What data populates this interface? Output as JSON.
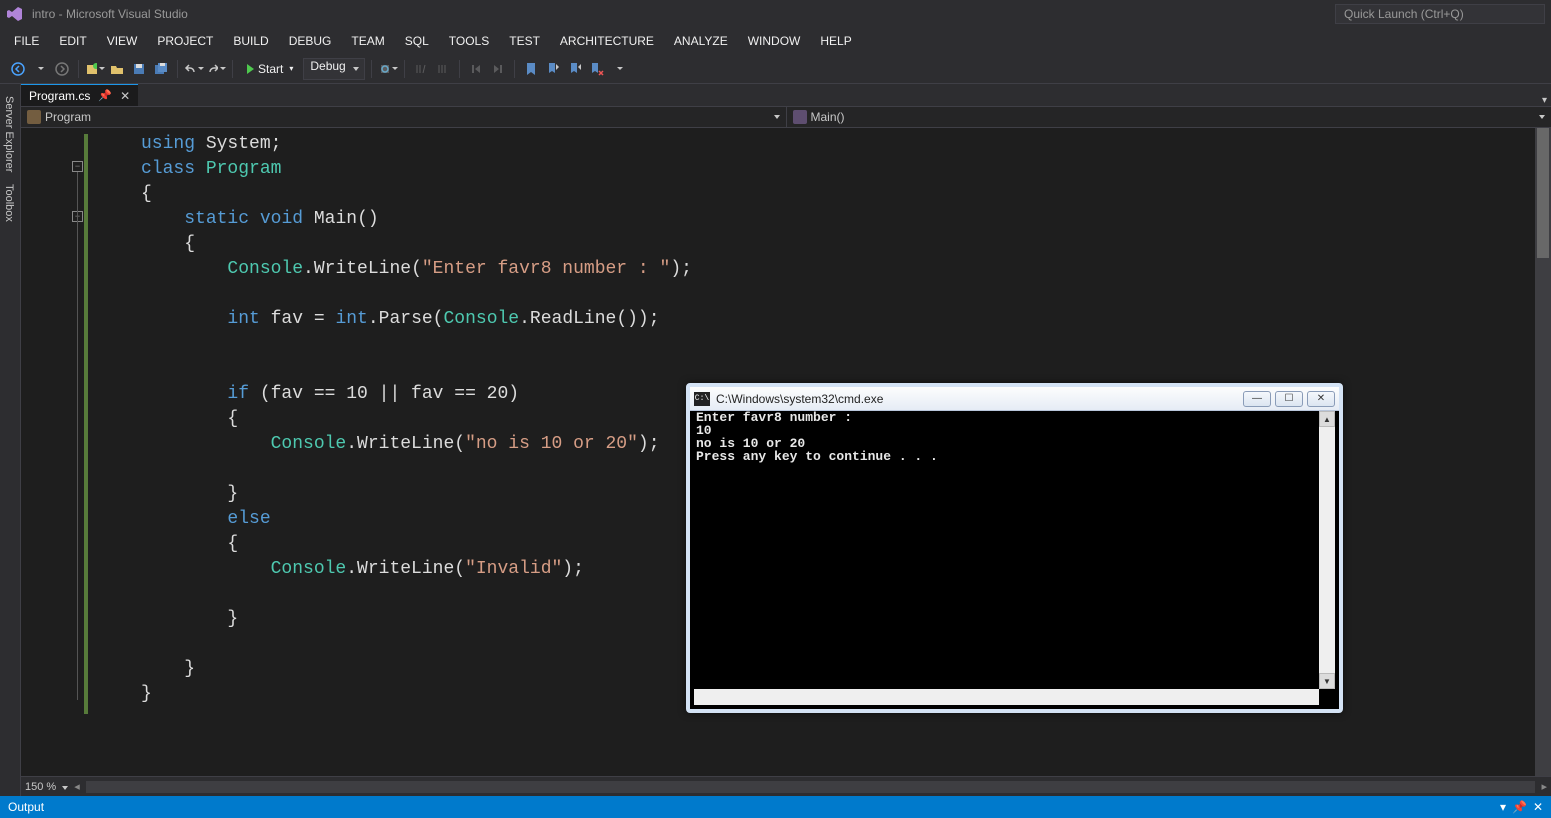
{
  "title": "intro - Microsoft Visual Studio",
  "quicklaunch_placeholder": "Quick Launch (Ctrl+Q)",
  "menus": [
    "FILE",
    "EDIT",
    "VIEW",
    "PROJECT",
    "BUILD",
    "DEBUG",
    "TEAM",
    "SQL",
    "TOOLS",
    "TEST",
    "ARCHITECTURE",
    "ANALYZE",
    "WINDOW",
    "HELP"
  ],
  "toolbar": {
    "start_label": "Start",
    "config": "Debug"
  },
  "side_tabs": [
    "Server Explorer",
    "Toolbox"
  ],
  "doc_tab": {
    "label": "Program.cs"
  },
  "nav": {
    "left": "Program",
    "right": "Main()"
  },
  "code_tokens": [
    [
      {
        "c": "kw",
        "t": "using"
      },
      {
        "c": "pln",
        "t": " "
      },
      {
        "c": "pln",
        "t": "System;"
      }
    ],
    [
      {
        "c": "kw",
        "t": "class"
      },
      {
        "c": "pln",
        "t": " "
      },
      {
        "c": "cls",
        "t": "Program"
      }
    ],
    [
      {
        "c": "pln",
        "t": "{"
      }
    ],
    [
      {
        "c": "pln",
        "t": "    "
      },
      {
        "c": "kw",
        "t": "static"
      },
      {
        "c": "pln",
        "t": " "
      },
      {
        "c": "kw",
        "t": "void"
      },
      {
        "c": "pln",
        "t": " Main()"
      }
    ],
    [
      {
        "c": "pln",
        "t": "    {"
      }
    ],
    [
      {
        "c": "pln",
        "t": "        "
      },
      {
        "c": "cls",
        "t": "Console"
      },
      {
        "c": "pln",
        "t": ".WriteLine("
      },
      {
        "c": "str",
        "t": "\"Enter favr8 number : \""
      },
      {
        "c": "pln",
        "t": ");"
      }
    ],
    [
      {
        "c": "pln",
        "t": ""
      }
    ],
    [
      {
        "c": "pln",
        "t": "        "
      },
      {
        "c": "kw",
        "t": "int"
      },
      {
        "c": "pln",
        "t": " fav = "
      },
      {
        "c": "kw",
        "t": "int"
      },
      {
        "c": "pln",
        "t": ".Parse("
      },
      {
        "c": "cls",
        "t": "Console"
      },
      {
        "c": "pln",
        "t": ".ReadLine());"
      }
    ],
    [
      {
        "c": "pln",
        "t": ""
      }
    ],
    [
      {
        "c": "pln",
        "t": ""
      }
    ],
    [
      {
        "c": "pln",
        "t": "        "
      },
      {
        "c": "kw",
        "t": "if"
      },
      {
        "c": "pln",
        "t": " (fav == 10 || fav == 20)"
      }
    ],
    [
      {
        "c": "pln",
        "t": "        {"
      }
    ],
    [
      {
        "c": "pln",
        "t": "            "
      },
      {
        "c": "cls",
        "t": "Console"
      },
      {
        "c": "pln",
        "t": ".WriteLine("
      },
      {
        "c": "str",
        "t": "\"no is 10 or 20\""
      },
      {
        "c": "pln",
        "t": ");"
      }
    ],
    [
      {
        "c": "pln",
        "t": ""
      }
    ],
    [
      {
        "c": "pln",
        "t": "        }"
      }
    ],
    [
      {
        "c": "pln",
        "t": "        "
      },
      {
        "c": "kw",
        "t": "else"
      }
    ],
    [
      {
        "c": "pln",
        "t": "        {"
      }
    ],
    [
      {
        "c": "pln",
        "t": "            "
      },
      {
        "c": "cls",
        "t": "Console"
      },
      {
        "c": "pln",
        "t": ".WriteLine("
      },
      {
        "c": "str",
        "t": "\"Invalid\""
      },
      {
        "c": "pln",
        "t": ");"
      }
    ],
    [
      {
        "c": "pln",
        "t": ""
      }
    ],
    [
      {
        "c": "pln",
        "t": "        }"
      }
    ],
    [
      {
        "c": "pln",
        "t": ""
      }
    ],
    [
      {
        "c": "pln",
        "t": "    }"
      }
    ],
    [
      {
        "c": "pln",
        "t": "}"
      }
    ]
  ],
  "zoom": "150 %",
  "output_label": "Output",
  "cmd": {
    "title": "C:\\Windows\\system32\\cmd.exe",
    "lines": [
      "Enter favr8 number :",
      "10",
      "no is 10 or 20",
      "Press any key to continue . . ."
    ]
  }
}
